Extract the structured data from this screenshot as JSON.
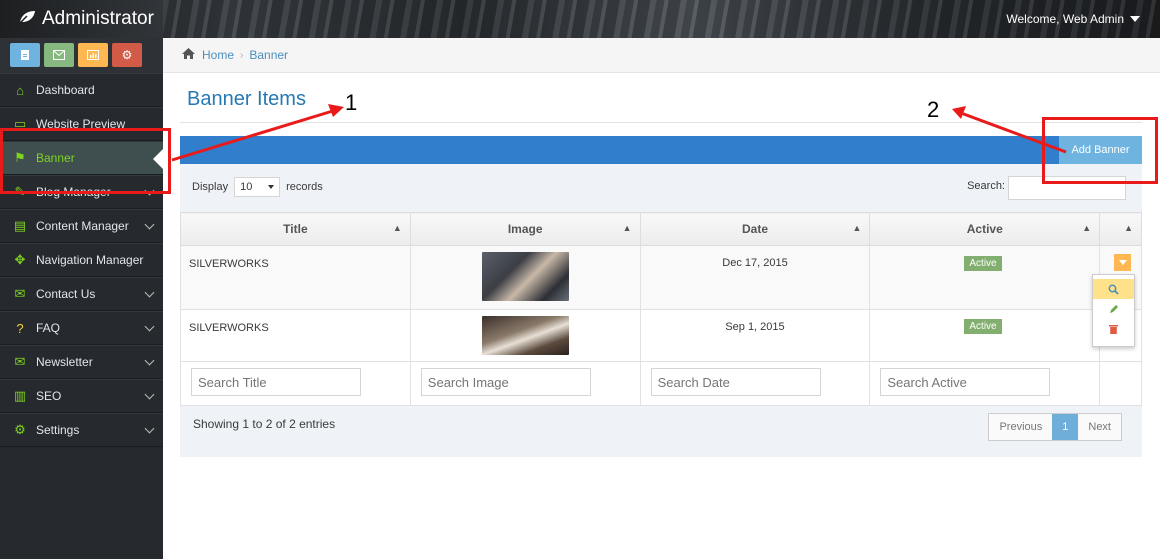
{
  "header": {
    "brand": "Administrator",
    "welcome": "Welcome, Web Admin"
  },
  "sidebar": {
    "shortcut_colors": [
      "#6fb3e0",
      "#87b87f",
      "#ffb752",
      "#d15b47"
    ],
    "items": [
      {
        "label": "Dashboard",
        "icon": "home-icon",
        "chevron": false
      },
      {
        "label": "Website Preview",
        "icon": "monitor-icon",
        "chevron": false
      },
      {
        "label": "Banner",
        "icon": "flag-icon",
        "chevron": false,
        "active": true
      },
      {
        "label": "Blog Manager",
        "icon": "blog-icon",
        "chevron": true
      },
      {
        "label": "Content Manager",
        "icon": "file-icon",
        "chevron": true
      },
      {
        "label": "Navigation Manager",
        "icon": "arrows-icon",
        "chevron": false
      },
      {
        "label": "Contact Us",
        "icon": "envelope-icon",
        "chevron": true
      },
      {
        "label": "FAQ",
        "icon": "question-icon",
        "chevron": true
      },
      {
        "label": "Newsletter",
        "icon": "envelope-icon",
        "chevron": true
      },
      {
        "label": "SEO",
        "icon": "chart-icon",
        "chevron": true
      },
      {
        "label": "Settings",
        "icon": "gears-icon",
        "chevron": true
      }
    ]
  },
  "breadcrumb": {
    "home": "Home",
    "current": "Banner"
  },
  "main": {
    "title": "Banner Items",
    "add_button": "Add Banner",
    "display_label": "Display",
    "display_value": "10",
    "records_label": "records",
    "search_label": "Search:",
    "columns": [
      "Title",
      "Image",
      "Date",
      "Active"
    ],
    "rows": [
      {
        "title": "SILVERWORKS",
        "date": "Dec 17, 2015",
        "active": "Active"
      },
      {
        "title": "SILVERWORKS",
        "date": "Sep 1, 2015",
        "active": "Active"
      }
    ],
    "filters": {
      "title": "Search Title",
      "image": "Search Image",
      "date": "Search Date",
      "active": "Search Active"
    },
    "showing": "Showing 1 to 2 of 2 entries",
    "pager": {
      "prev": "Previous",
      "page": "1",
      "next": "Next"
    }
  },
  "annotations": {
    "one": "1",
    "two": "2"
  }
}
